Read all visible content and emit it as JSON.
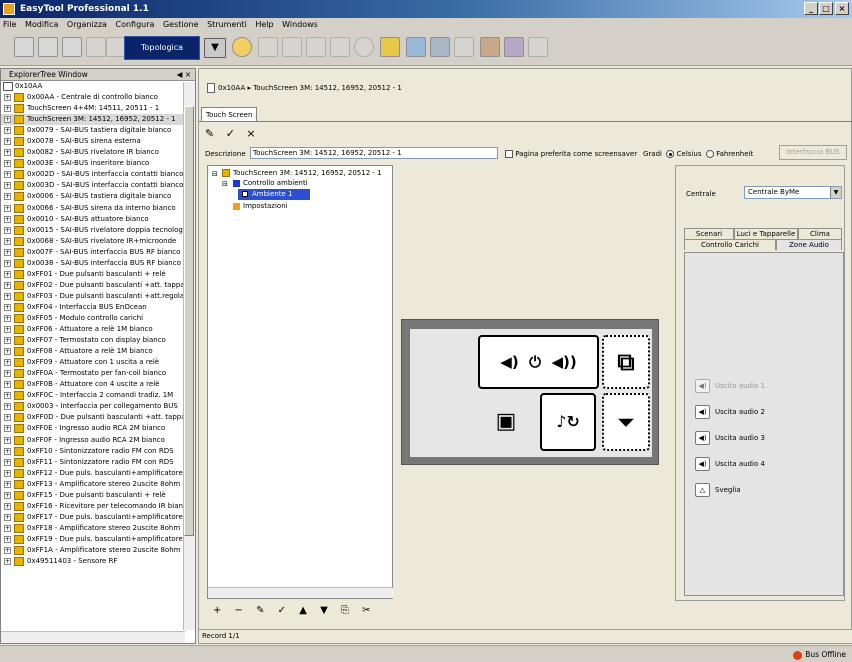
{
  "window": {
    "title": "EasyTool Professional 1.1",
    "controls": [
      "_",
      "□",
      "×"
    ]
  },
  "menu": [
    "File",
    "Modifica",
    "Organizza",
    "Configura",
    "Gestione",
    "Strumenti",
    "Help",
    "Windows"
  ],
  "toolbar": {
    "view_label": "Topologica",
    "dropdown_glyph": "▼"
  },
  "explorer": {
    "title": "ExplorerTree Window",
    "controls": "◀ ×",
    "root": "0x10AA",
    "items": [
      "0x00AA - Centrale di controllo bianco",
      "TouchScreen 4+4M: 14511, 20511 - 1",
      "TouchScreen 3M: 14512, 16952, 20512 - 1",
      "0x0079 - SAI-BUS tastiera digitale bianco",
      "0x0078 - SAI-BUS sirena esterna",
      "0x0082 - SAI-BUS rivelatore IR bianco",
      "0x003E - SAI-BUS inseritore bianco",
      "0x002D - SAI-BUS interfaccia contatti bianco",
      "0x003D - SAI-BUS interfaccia contatti bianco",
      "0x0006 - SAI-BUS tastiera digitale bianco",
      "0x0066 - SAI-BUS sirena da interno bianco",
      "0x0010 - SAI-BUS attuatore bianco",
      "0x0015 - SAI-BUS rivelatore doppia tecnologia",
      "0x0068 - SAI-BUS rivelatore IR+microonde",
      "0x007F - SAI-BUS interfaccia BUS RF bianco",
      "0x0038 - SAI-BUS interfaccia BUS RF bianco",
      "0xFF01 - Due pulsanti basculanti + relè",
      "0xFF02 - Due pulsanti basculanti +att. tapparelle",
      "0xFF03 - Due pulsanti basculanti +att.regolatore",
      "0xFF04 - Interfaccia BUS EnOcean",
      "0xFF05 - Modulo controllo carichi",
      "0xFF06 - Attuatore a relè 1M bianco",
      "0xFF07 - Termostato con display bianco",
      "0xFF08 - Attuatore a relè 1M bianco",
      "0xFF09 - Attuatore con 1 uscita a relè",
      "0xFF0A - Termostato per fan-coil bianco",
      "0xFF0B - Attuatore con 4 uscite a relè",
      "0xFF0C - Interfaccia 2 comandi tradiz. 1M",
      "0x0003 - Interfaccia per collegamento BUS",
      "0xFF0D - Due pulsanti basculanti +att. tapparelle",
      "0xFF0E - Ingresso audio RCA 2M bianco",
      "0xFF0F - Ingresso audio RCA 2M bianco",
      "0xFF10 - Sintonizzatore radio FM con RDS",
      "0xFF11 - Sintonizzatore radio FM con RDS",
      "0xFF12 - Due puls. basculanti+amplificatore",
      "0xFF13 - Amplificatore stereo 2uscite 8ohm",
      "0xFF15 - Due pulsanti basculanti + relè",
      "0xFF16 - Ricevitore per telecomando IR bianco",
      "0xFF17 - Due puls. basculanti+amplificatore",
      "0xFF18 - Amplificatore stereo 2uscite 8ohm",
      "0xFF19 - Due puls. basculanti+amplificatore",
      "0xFF1A - Amplificatore stereo 2uscite 8ohm",
      "0x49511403 - Sensore RF"
    ]
  },
  "main": {
    "breadcrumb": {
      "root": "0x10AA",
      "sep": "▸",
      "device": "TouchScreen 3M: 14512, 16952, 20512 - 1"
    },
    "tab": "Touch Screen",
    "actions": "✎ ✓ ×",
    "description_label": "Descrizione",
    "description_value": "TouchScreen 3M: 14512, 16952, 20512 - 1",
    "preferred_label": "Pagina preferita come screensaver",
    "degrees_label": "Gradi",
    "celsius": "Celsius",
    "fahrenheit": "Fahrenheit",
    "interface_button": "Interfaccia BUS",
    "tree": {
      "root": "TouchScreen 3M: 14512, 16952, 20512 - 1",
      "controllo": "Controllo ambienti",
      "ambiente": "Ambiente 1",
      "impostazioni": "Impostazioni"
    },
    "tree_buttons": "+ − ✎ ✓ ▲ ▼ ⎘ ✂",
    "record": "Record 1/1"
  },
  "preview": {
    "speaker_left": "◀)",
    "power": "⏻",
    "speaker_right": "◀))",
    "copy": "⧉",
    "radio": "▣",
    "music": "♪↻",
    "funnel": "⏷"
  },
  "right_panel": {
    "centrale_label": "Centrale",
    "centrale_value": "Centrale ByMe",
    "tabs_row1": [
      "Scenari",
      "Luci e Tapparelle",
      "Clima"
    ],
    "tabs_row2": [
      "Controllo Carichi",
      "Zone Audio"
    ],
    "audio": [
      "Uscita audio 1",
      "Uscita audio 2",
      "Uscita audio 3",
      "Uscita audio 4",
      "Sveglia"
    ]
  },
  "status": {
    "bus": "Bus Offline"
  },
  "colors": {
    "accent": "#0a246a",
    "folder": "#e6b400",
    "selected": "#2a4fd0",
    "offline": "#e04010"
  }
}
